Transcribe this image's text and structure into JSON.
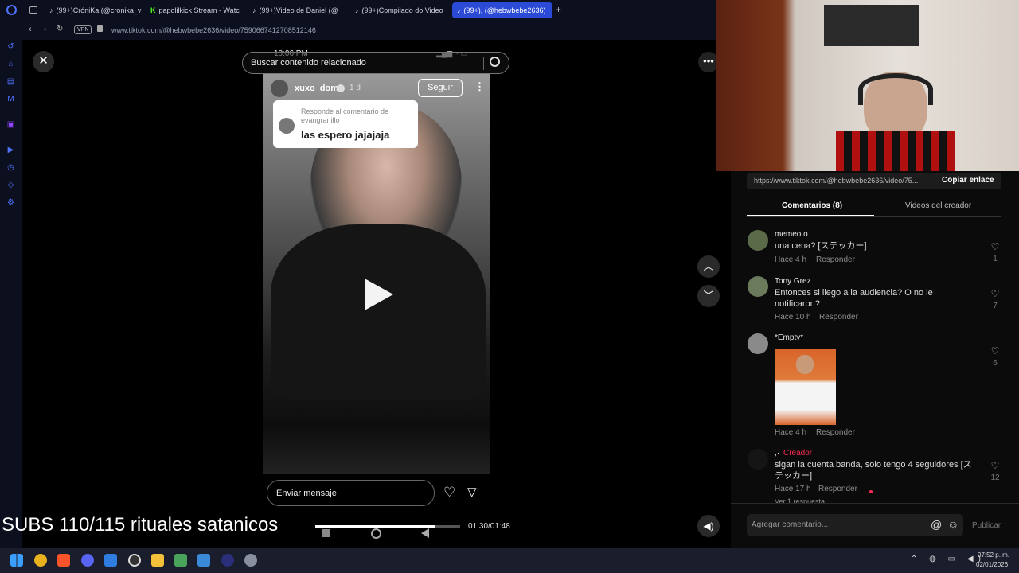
{
  "browser": {
    "tabs": [
      {
        "label": "(99+)CróniKa (@cronika_v",
        "active": false
      },
      {
        "label": "papolilkick Stream - Watc",
        "active": false
      },
      {
        "label": "(99+)Video de Daniel (@",
        "active": false
      },
      {
        "label": "(99+)Compilado do Video",
        "active": false
      },
      {
        "label": "(99+), (@hebwbebe2636)",
        "active": true
      }
    ],
    "vpn_label": "VPN",
    "url": "www.tiktok.com/@hebwbebe2636/video/7590667412708512146"
  },
  "search": {
    "placeholder": "Buscar contenido relacionado"
  },
  "phone_status": {
    "time": "10:06 PM"
  },
  "post": {
    "username": "xuxo_dom",
    "age": "1 d",
    "follow_label": "Seguir",
    "reply_header": "Responde al comentario de evangranillo",
    "reply_text": "las espero jajajaja",
    "message_placeholder": "Enviar mensaje"
  },
  "player": {
    "time": "01:30/01:48",
    "progress": 0.83
  },
  "overlay_text": "SUBS 110/115 rituales satanicos",
  "share": {
    "link": "https://www.tiktok.com/@hebwbebe2636/video/75...",
    "copy_label": "Copiar enlace"
  },
  "tabs": {
    "comments": "Comentarios (8)",
    "creator_videos": "Videos del creador"
  },
  "comments": [
    {
      "name": "memeo.o",
      "text": "una cena? [ステッカー]",
      "time": "Hace 4 h",
      "reply": "Responder",
      "likes": "1"
    },
    {
      "name": "Tony Grez",
      "text": "Entonces si llego a la audiencia? O no le notificaron?",
      "time": "Hace 10 h",
      "reply": "Responder",
      "likes": "7"
    },
    {
      "name": "*Empty*",
      "text": "",
      "time": "Hace 4 h",
      "reply": "Responder",
      "likes": "6"
    },
    {
      "name": ",·",
      "badge": "Creador",
      "text": "sigan la cuenta banda, solo tengo 4 seguidores [ステッカー]",
      "time": "Hace 17 h",
      "reply": "Responder",
      "likes": "12"
    }
  ],
  "more_replies": "Ver 1 respuesta",
  "add_comment": {
    "placeholder": "Agregar comentario...",
    "publish_label": "Publicar"
  },
  "clock": {
    "time": "07:52 p. m.",
    "date": "02/01/2026"
  },
  "colors": {
    "accent_red": "#fe2c55",
    "browser_blue": "#2b4bd6",
    "taskbar": "#1a1d2b"
  }
}
